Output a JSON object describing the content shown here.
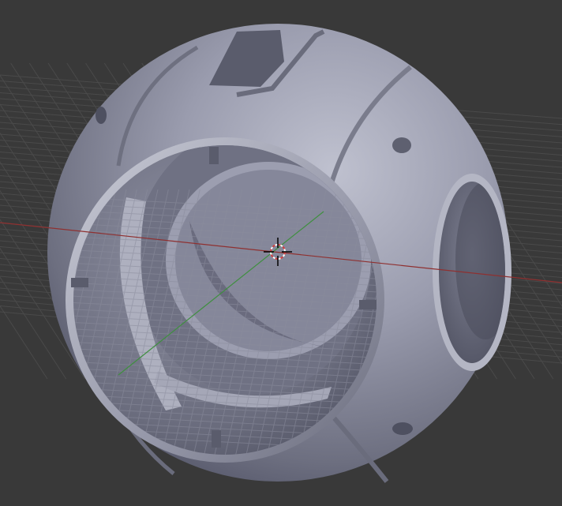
{
  "viewport": {
    "background": "#393939",
    "grid_color": "#4a4a4a",
    "x_axis_color": "#8f3030",
    "y_axis_color": "#3f8f3f",
    "object_color": "#9a9cae",
    "shadow_color": "#5d5f6e",
    "highlight_color": "#c4c6d2"
  },
  "cursor": {
    "icon": "3d-cursor-icon"
  }
}
